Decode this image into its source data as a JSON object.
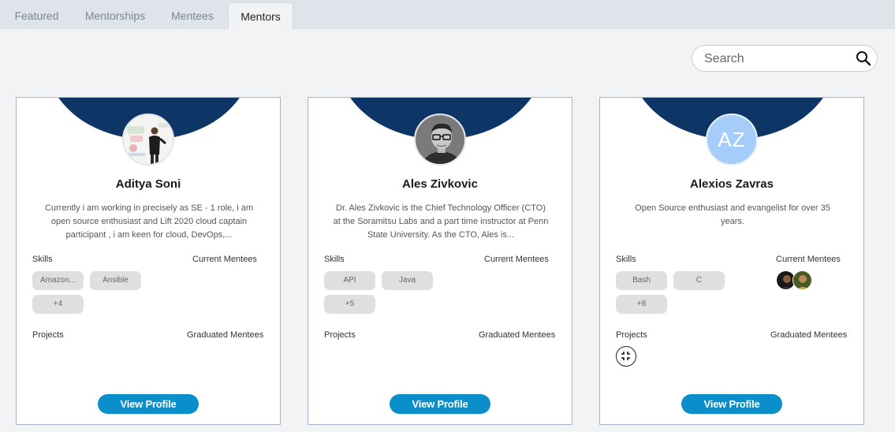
{
  "tabs": [
    {
      "label": "Featured"
    },
    {
      "label": "Mentorships"
    },
    {
      "label": "Mentees"
    },
    {
      "label": "Mentors"
    }
  ],
  "active_tab": "Mentors",
  "search": {
    "placeholder": "Search",
    "icon": "search-icon"
  },
  "section_labels": {
    "skills": "Skills",
    "current_mentees": "Current Mentees",
    "projects": "Projects",
    "graduated_mentees": "Graduated Mentees"
  },
  "cards": [
    {
      "name": "Aditya Soni",
      "bio": "Currently i am working in precisely as SE - 1 role, i am open source enthusiast and Lift 2020 cloud captain participant , i am keen for cloud, DevOps,...",
      "skills": [
        "Amazon...",
        "Ansible"
      ],
      "more_skills": "+4",
      "button": "View Profile"
    },
    {
      "name": "Ales Zivkovic",
      "bio": "Dr. Ales Zivkovic is the Chief Technology Officer (CTO) at the Soramitsu Labs and a part time instructor at Penn State University. As the CTO, Ales is...",
      "skills": [
        "API",
        "Java"
      ],
      "more_skills": "+5",
      "button": "View Profile"
    },
    {
      "name": "Alexios Zavras",
      "initials": "AZ",
      "bio": "Open Source enthusiast and evangelist for over 35 years.",
      "skills": [
        "Bash",
        "C"
      ],
      "more_skills": "+8",
      "button": "View Profile"
    }
  ],
  "colors": {
    "arc": "#0d3565",
    "button": "#0a8fca",
    "chip": "#dfdfdf",
    "initials_avatar": "#a6cdfa"
  }
}
